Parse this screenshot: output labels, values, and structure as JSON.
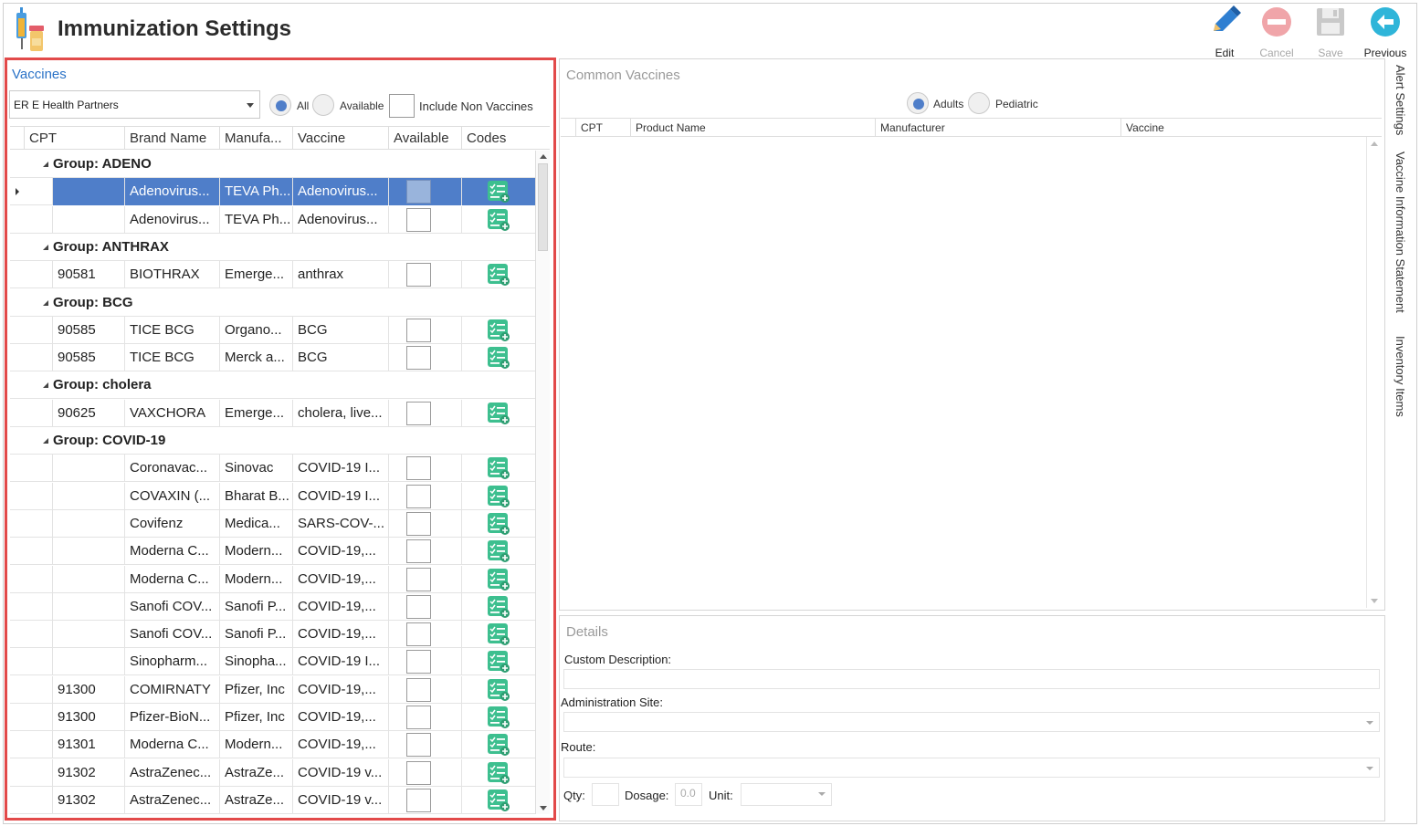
{
  "header": {
    "title": "Immunization Settings",
    "toolbar": {
      "edit": "Edit",
      "cancel": "Cancel",
      "save": "Save",
      "previous": "Previous"
    }
  },
  "vaccines": {
    "title": "Vaccines",
    "practice": "ER E Health Partners",
    "filter_all": "All",
    "filter_available": "Available",
    "include_non_vaccines": "Include Non Vaccines",
    "columns": [
      "CPT",
      "Brand Name",
      "Manufa...",
      "Vaccine",
      "Available",
      "Codes"
    ],
    "rows": [
      {
        "group": "Group: ADENO"
      },
      {
        "cpt": "",
        "brand": "Adenovirus...",
        "mfr": "TEVA Ph...",
        "vaccine": "Adenovirus...",
        "selected": true
      },
      {
        "cpt": "",
        "brand": "Adenovirus...",
        "mfr": "TEVA Ph...",
        "vaccine": "Adenovirus..."
      },
      {
        "group": "Group: ANTHRAX"
      },
      {
        "cpt": "90581",
        "brand": "BIOTHRAX",
        "mfr": "Emerge...",
        "vaccine": "anthrax"
      },
      {
        "group": "Group: BCG"
      },
      {
        "cpt": "90585",
        "brand": "TICE BCG",
        "mfr": "Organo...",
        "vaccine": "BCG"
      },
      {
        "cpt": "90585",
        "brand": "TICE BCG",
        "mfr": "Merck a...",
        "vaccine": "BCG"
      },
      {
        "group": "Group: cholera"
      },
      {
        "cpt": "90625",
        "brand": "VAXCHORA",
        "mfr": "Emerge...",
        "vaccine": "cholera, live..."
      },
      {
        "group": "Group: COVID-19"
      },
      {
        "cpt": "",
        "brand": "Coronavac...",
        "mfr": "Sinovac",
        "vaccine": "COVID-19 I..."
      },
      {
        "cpt": "",
        "brand": "COVAXIN (...",
        "mfr": "Bharat B...",
        "vaccine": "COVID-19 I..."
      },
      {
        "cpt": "",
        "brand": "Covifenz",
        "mfr": "Medica...",
        "vaccine": "SARS-COV-..."
      },
      {
        "cpt": "",
        "brand": "Moderna C...",
        "mfr": "Modern...",
        "vaccine": "COVID-19,..."
      },
      {
        "cpt": "",
        "brand": "Moderna C...",
        "mfr": "Modern...",
        "vaccine": "COVID-19,..."
      },
      {
        "cpt": "",
        "brand": "Sanofi COV...",
        "mfr": "Sanofi P...",
        "vaccine": "COVID-19,..."
      },
      {
        "cpt": "",
        "brand": "Sanofi COV...",
        "mfr": "Sanofi P...",
        "vaccine": "COVID-19,..."
      },
      {
        "cpt": "",
        "brand": "Sinopharm...",
        "mfr": "Sinopha...",
        "vaccine": "COVID-19 I..."
      },
      {
        "cpt": "91300",
        "brand": "COMIRNATY",
        "mfr": "Pfizer, Inc",
        "vaccine": "COVID-19,..."
      },
      {
        "cpt": "91300",
        "brand": "Pfizer-BioN...",
        "mfr": "Pfizer, Inc",
        "vaccine": "COVID-19,..."
      },
      {
        "cpt": "91301",
        "brand": "Moderna C...",
        "mfr": "Modern...",
        "vaccine": "COVID-19,..."
      },
      {
        "cpt": "91302",
        "brand": "AstraZenec...",
        "mfr": "AstraZe...",
        "vaccine": "COVID-19 v..."
      },
      {
        "cpt": "91302",
        "brand": "AstraZenec...",
        "mfr": "AstraZe...",
        "vaccine": "COVID-19 v..."
      }
    ]
  },
  "common": {
    "title": "Common Vaccines",
    "adults": "Adults",
    "pediatric": "Pediatric",
    "columns": [
      "CPT",
      "Product Name",
      "Manufacturer",
      "Vaccine"
    ]
  },
  "details": {
    "title": "Details",
    "custom_description": "Custom Description:",
    "admin_site": "Administration Site:",
    "route": "Route:",
    "qty": "Qty:",
    "dosage": "Dosage:",
    "dosage_value": "0.0",
    "unit": "Unit:"
  },
  "side_tabs": [
    "Alert Settings",
    "Vaccine Information Statement",
    "Inventory Items"
  ],
  "colors": {
    "accent": "#4f7ec9",
    "highlight_border": "#e24a4a",
    "codes_icon": "#3dbf8f",
    "previous_icon": "#2fb5d9",
    "edit_icon": "#2f7fd1"
  }
}
